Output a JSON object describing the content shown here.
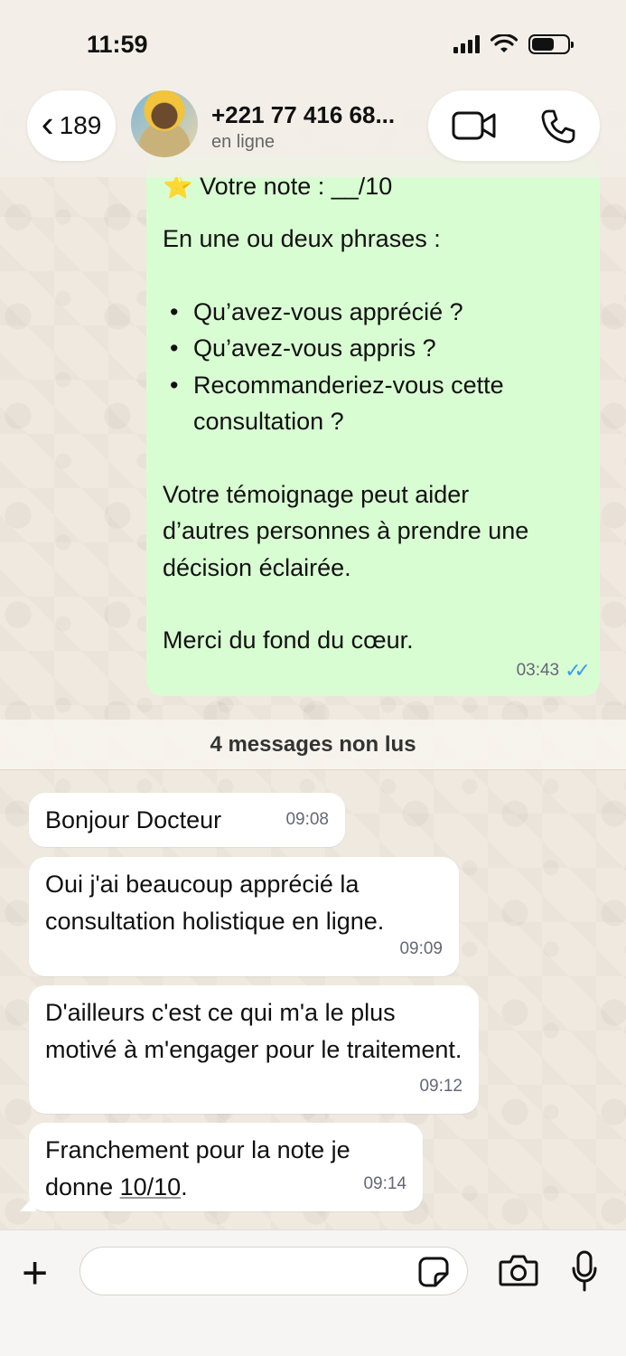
{
  "status_bar": {
    "time": "11:59"
  },
  "header": {
    "back_count": "189",
    "contact_name": "+221 77 416 68...",
    "contact_status": "en ligne"
  },
  "outgoing": {
    "clipped_line": "⭐ Votre note : __/10",
    "intro": "En une ou deux phrases :",
    "bullets": [
      "Qu’avez-vous apprécié ?",
      "Qu’avez-vous appris ?",
      "Recommanderiez-vous cette consultation ?"
    ],
    "testimony": "Votre témoignage peut aider d’autres personnes à prendre une décision éclairée.",
    "thanks": "Merci du fond du cœur.",
    "time": "03:43",
    "read_ticks": "✓✓"
  },
  "unread_label": "4 messages non lus",
  "incoming": [
    {
      "text": "Bonjour Docteur",
      "time": "09:08"
    },
    {
      "text": "Oui j'ai beaucoup apprécié la consultation holistique en ligne.",
      "time": "09:09"
    },
    {
      "text": "D'ailleurs c'est ce qui m'a le plus motivé à m'engager pour le traitement.",
      "time": "09:12"
    },
    {
      "text_before": "Franchement pour la note je donne ",
      "text_link": "10/10",
      "text_after": ".",
      "time": "09:14"
    }
  ],
  "input": {
    "plus": "+",
    "placeholder": ""
  },
  "colors": {
    "outgoing_bubble": "#d9fdd3",
    "incoming_bubble": "#ffffff",
    "read_ticks": "#3b9bf0"
  }
}
